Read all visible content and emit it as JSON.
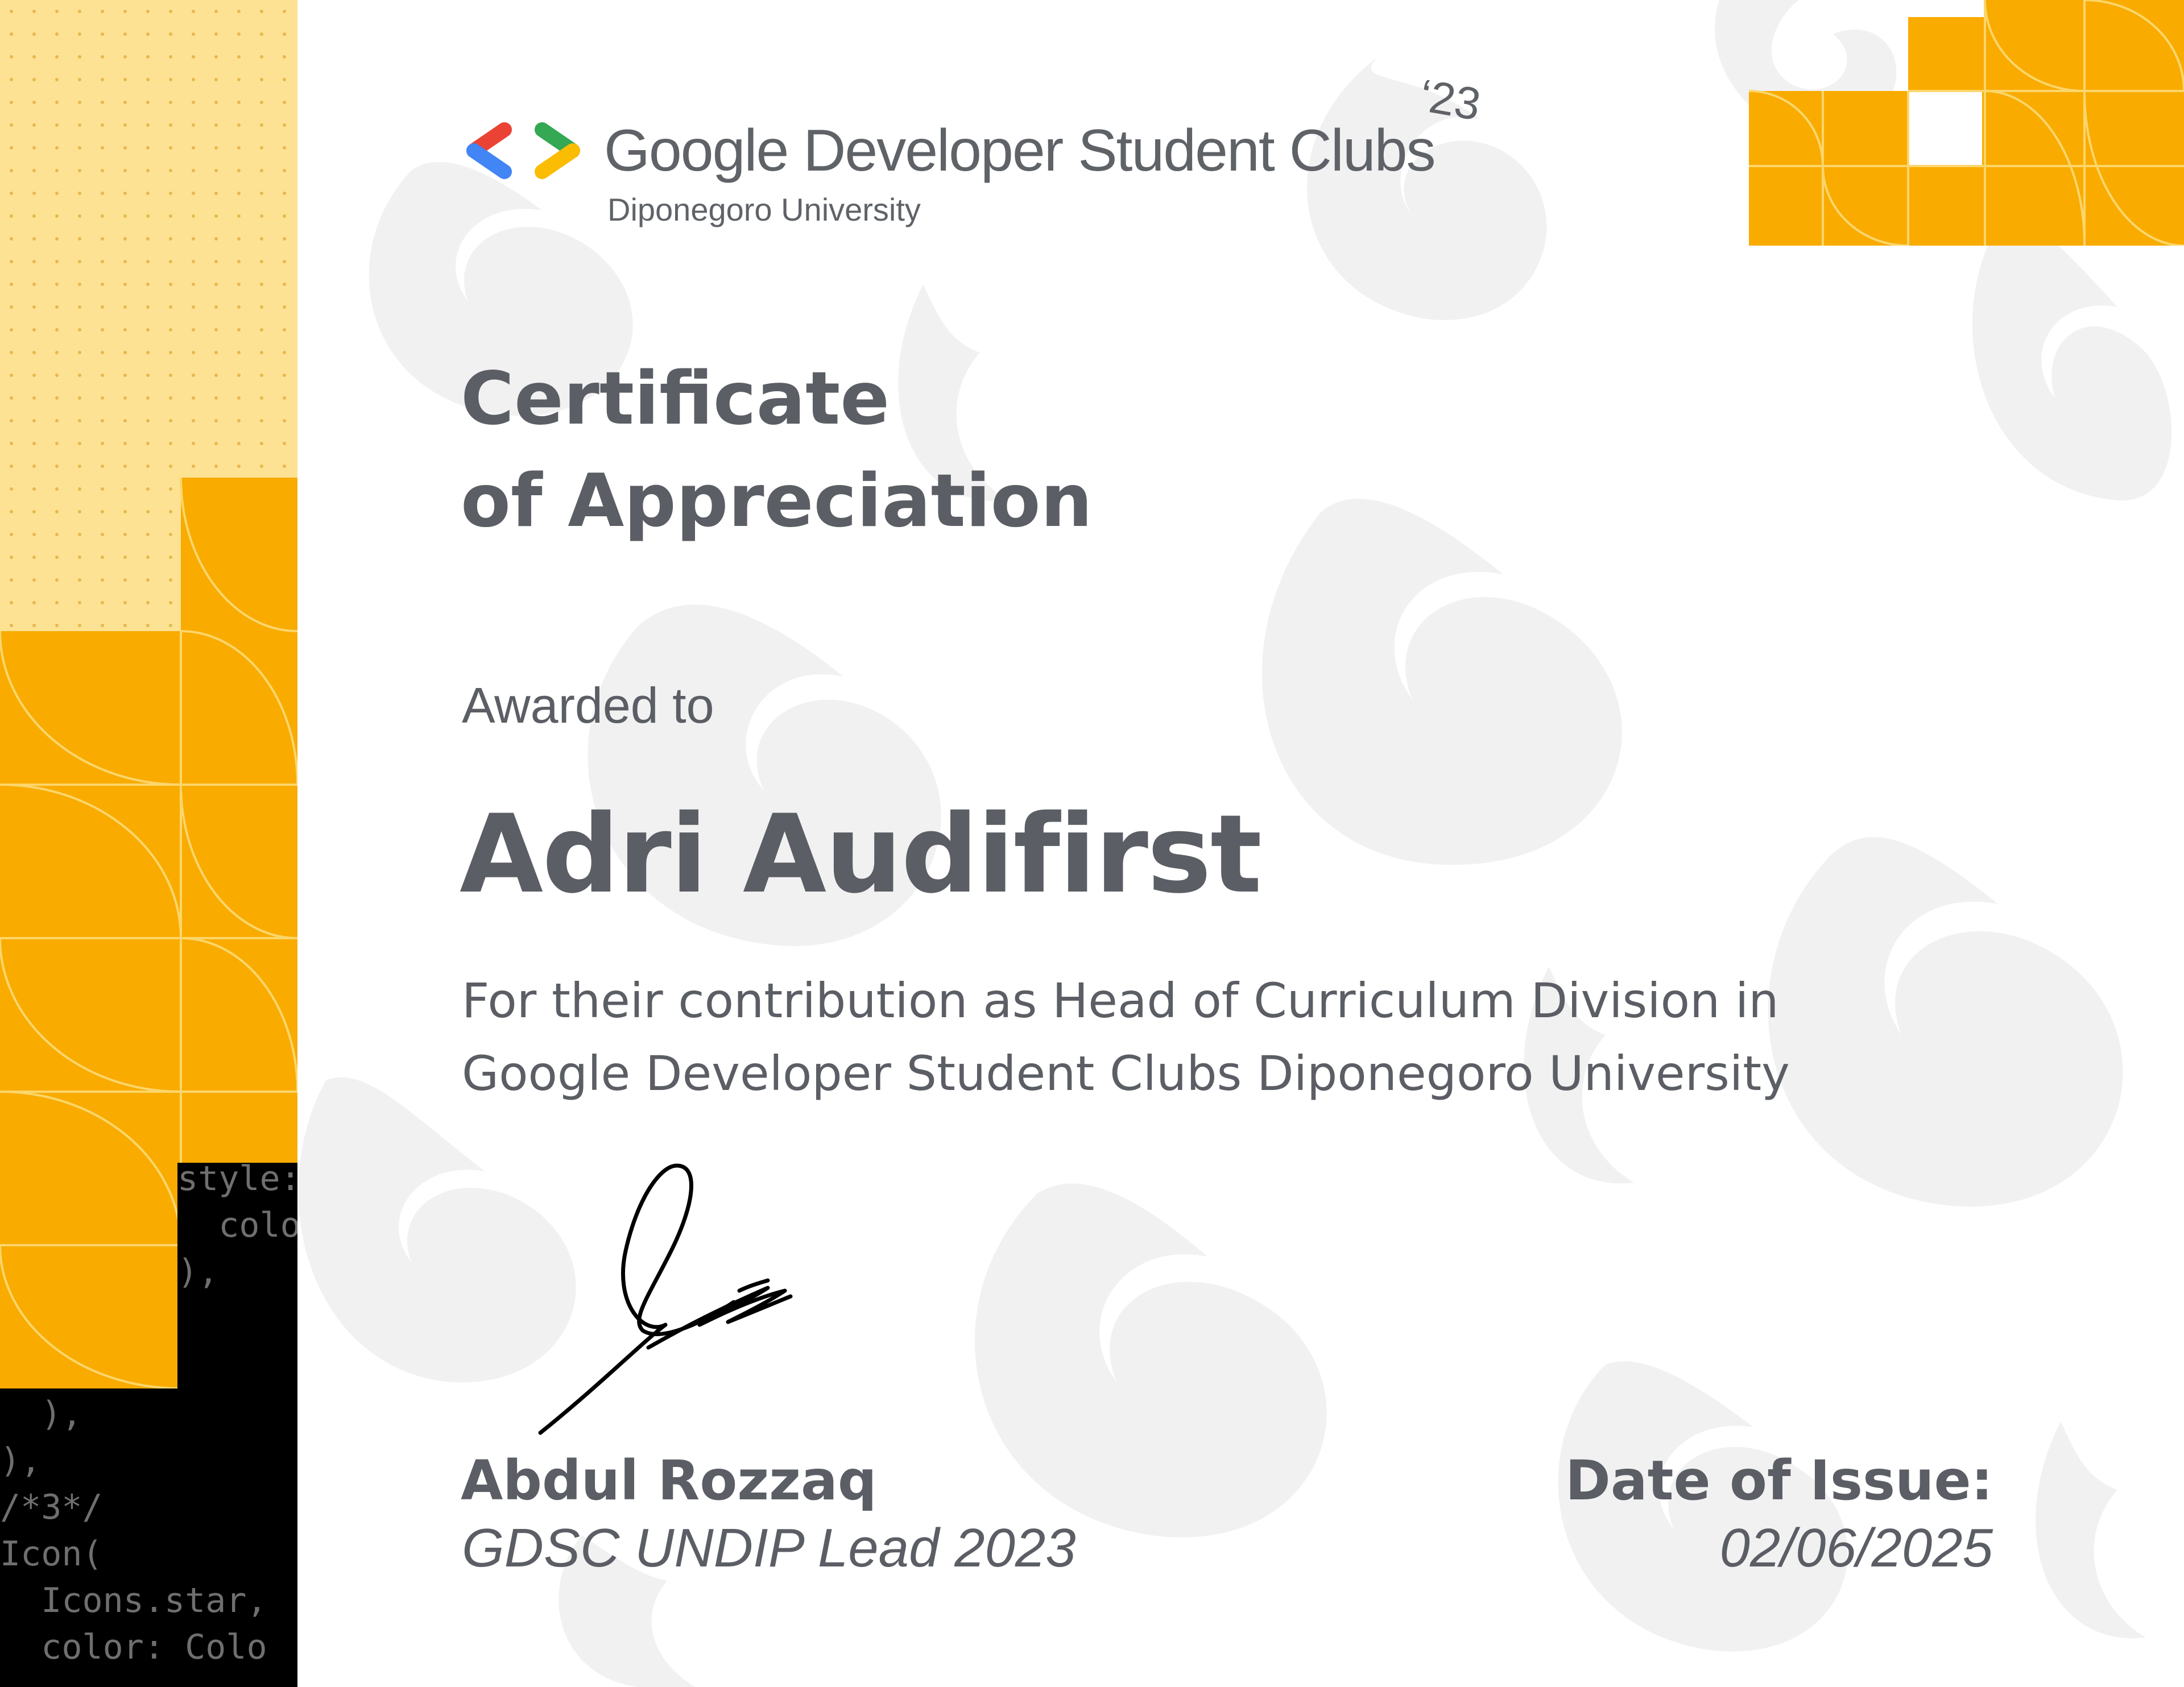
{
  "organization": {
    "name": "Google Developer Student Clubs",
    "year": "‘23",
    "chapter": "Diponegoro University"
  },
  "certificate": {
    "title_line1": "Certificate",
    "title_line2": "of Appreciation",
    "awarded_label": "Awarded to",
    "recipient": "Adri Audifirst",
    "contribution_line1": "For their contribution as Head of Curriculum Division in",
    "contribution_line2": "Google Developer Student Clubs Diponegoro University"
  },
  "signer": {
    "name": "Abdul Rozzaq",
    "role": "GDSC UNDIP Lead 2023"
  },
  "issue": {
    "label": "Date of Issue:",
    "date": "02/06/2025"
  },
  "decor": {
    "code_top": "style:\n  colo\n),",
    "code_bottom": "  ),\n),\n/*3*/\nIcon(\n  Icons.star,\n  color: Colo"
  },
  "icons": {
    "logo": "gdsc-brackets-icon"
  },
  "colors": {
    "accent_yellow": "#F9AB00",
    "light_yellow": "#FDE293",
    "text_gray": "#5B5E64",
    "google_blue": "#4285F4",
    "google_red": "#EA4335",
    "google_green": "#34A853",
    "google_yellow": "#FBBC04"
  }
}
